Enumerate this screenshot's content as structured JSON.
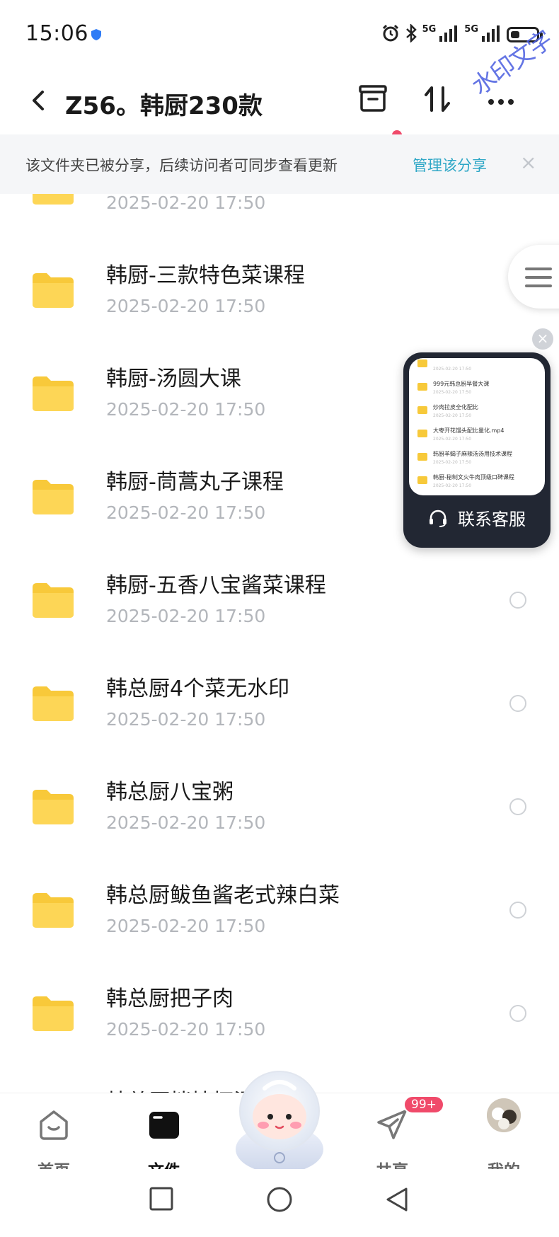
{
  "status_bar": {
    "time": "15:06",
    "net_1": "5G",
    "net_2": "5G",
    "battery_level": 0.35
  },
  "watermark": "水印文字",
  "header": {
    "title": "Z56。韩厨230款"
  },
  "banner": {
    "text": "该文件夹已被分享，后续访问者可同步查看更新",
    "link": "管理该分享",
    "close": "×"
  },
  "files": [
    {
      "name": "",
      "date": "2025-02-20  17:50"
    },
    {
      "name": "韩厨-三款特色菜课程",
      "date": "2025-02-20  17:50"
    },
    {
      "name": "韩厨-汤圆大课",
      "date": "2025-02-20  17:50"
    },
    {
      "name": "韩厨-茼蒿丸子课程",
      "date": "2025-02-20  17:50"
    },
    {
      "name": "韩厨-五香八宝酱菜课程",
      "date": "2025-02-20  17:50"
    },
    {
      "name": "韩总厨4个菜无水印",
      "date": "2025-02-20  17:50"
    },
    {
      "name": "韩总厨八宝粥",
      "date": "2025-02-20  17:50"
    },
    {
      "name": "韩总厨鲅鱼酱老式辣白菜",
      "date": "2025-02-20  17:50"
    },
    {
      "name": "韩总厨把子肉",
      "date": "2025-02-20  17:50"
    },
    {
      "name": "韩总厨拌桔梗湿",
      "date": ""
    }
  ],
  "service_widget": {
    "label": "联系客服",
    "preview_rows": [
      {
        "name": "",
        "date": "2025-02-20 17:50"
      },
      {
        "name": "999元韩总厨早餐大课",
        "date": "2025-02-20 17:50"
      },
      {
        "name": "炒肉拉皮全化配比",
        "date": "2025-02-20 17:50"
      },
      {
        "name": "大枣开花馒头配比量化.mp4",
        "date": "2025-02-20 17:50"
      },
      {
        "name": "韩厨羊蝎子麻辣汤汤用技术课程",
        "date": "2025-02-20 17:50"
      },
      {
        "name": "韩厨-秘制文火牛肉顶级口碑课程",
        "date": "2025-02-20 17:50"
      }
    ]
  },
  "tabbar": {
    "home": "首页",
    "files": "文件",
    "share": "共享",
    "share_badge": "99+",
    "mine": "我的"
  }
}
